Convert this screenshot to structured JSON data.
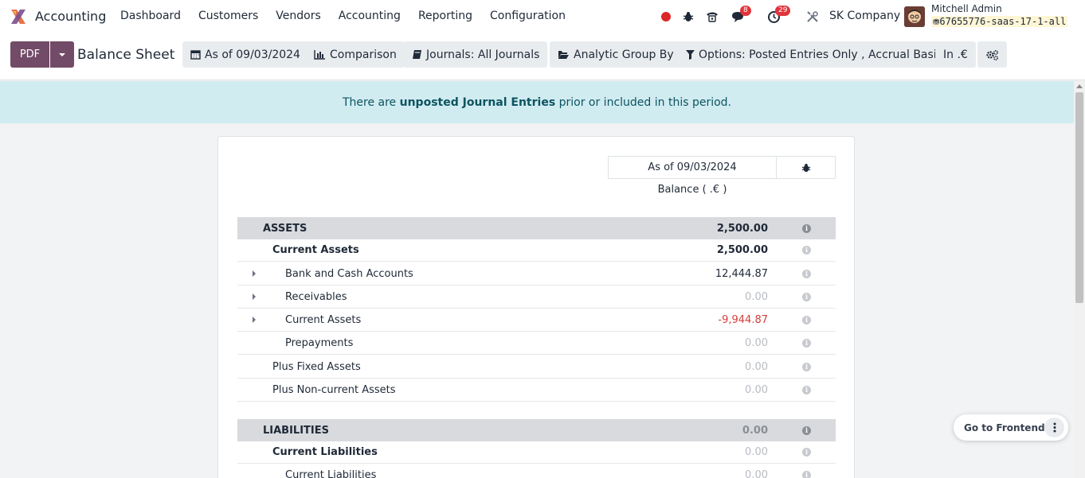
{
  "navbar": {
    "app_name": "Accounting",
    "menu": [
      "Dashboard",
      "Customers",
      "Vendors",
      "Accounting",
      "Reporting",
      "Configuration"
    ],
    "messages_badge": "8",
    "activities_badge": "29",
    "company": "SK Company",
    "user_name": "Mitchell Admin",
    "database": "67655776-saas-17-1-all"
  },
  "control": {
    "pdf_label": "PDF",
    "title": "Balance Sheet",
    "filters": [
      {
        "label": "As of 09/03/2024",
        "icon": "calendar-icon"
      },
      {
        "label": "Comparison",
        "icon": "bar-chart-icon"
      },
      {
        "label": "Journals: All Journals",
        "icon": "book-icon"
      },
      {
        "label": "Analytic Group By",
        "icon": "folder-open-icon"
      },
      {
        "label": "Options: Posted Entries Only , Accrual Basis",
        "icon": "filter-icon"
      },
      {
        "label": "In .€",
        "icon": ""
      }
    ],
    "settings_icon": "cogs-icon"
  },
  "alert": {
    "before": "There are ",
    "link": "unposted Journal Entries",
    "after": " prior or included in this period."
  },
  "report": {
    "column_header": "As of 09/03/2024",
    "column_sub": "Balance ( .€ )",
    "rows": [
      {
        "label": "ASSETS",
        "amount": "2,500.00",
        "level": "section"
      },
      {
        "label": "Current Assets",
        "amount": "2,500.00",
        "level": "group"
      },
      {
        "label": "Bank and Cash Accounts",
        "amount": "12,444.87",
        "level": "line",
        "expandable": true
      },
      {
        "label": "Receivables",
        "amount": "0.00",
        "level": "line",
        "expandable": true
      },
      {
        "label": "Current Assets",
        "amount": "-9,944.87",
        "level": "line",
        "expandable": true
      },
      {
        "label": "Prepayments",
        "amount": "0.00",
        "level": "line"
      },
      {
        "label": "Plus Fixed Assets",
        "amount": "0.00",
        "level": "plain"
      },
      {
        "label": "Plus Non-current Assets",
        "amount": "0.00",
        "level": "plain"
      },
      {
        "label": "LIABILITIES",
        "amount": "0.00",
        "level": "section"
      },
      {
        "label": "Current Liabilities",
        "amount": "0.00",
        "level": "group"
      },
      {
        "label": "Current Liabilities",
        "amount": "0.00",
        "level": "line"
      }
    ]
  },
  "frontend": {
    "label": "Go to Frontend"
  }
}
